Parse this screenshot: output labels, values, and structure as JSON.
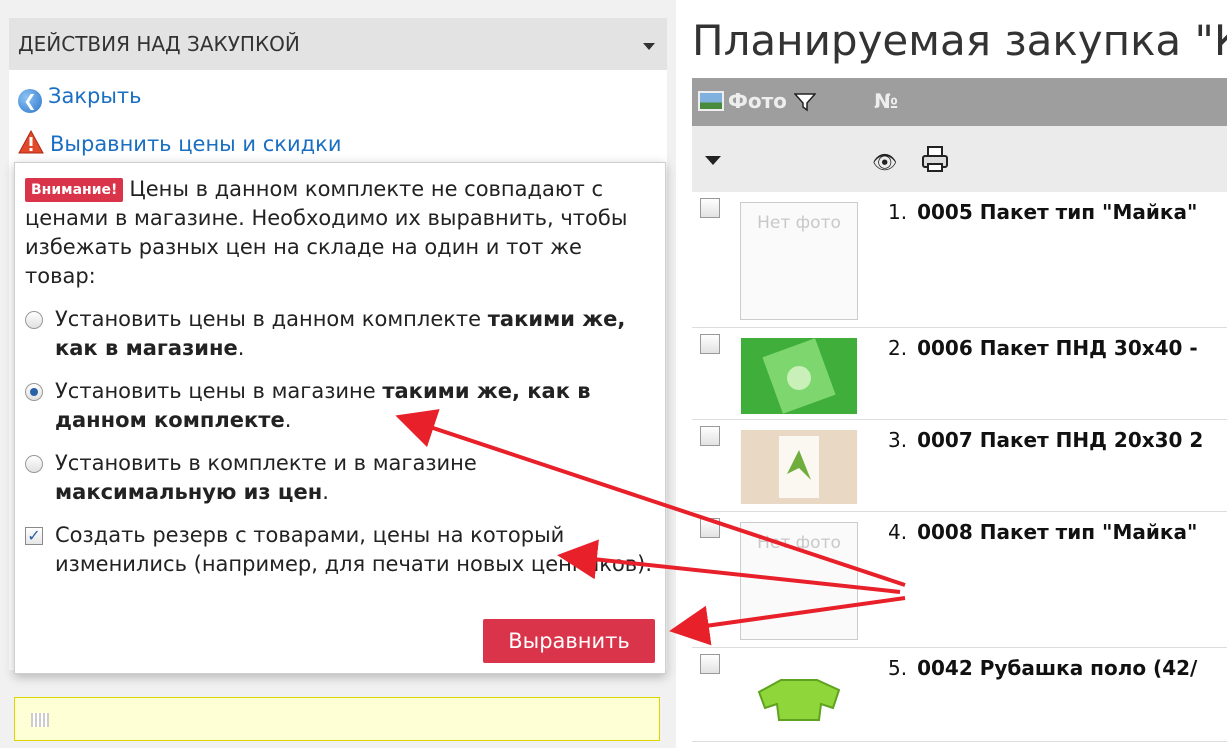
{
  "actions": {
    "header": "ДЕЙСТВИЯ НАД ЗАКУПКОЙ",
    "close_link": "Закрыть",
    "align_link": "Выравнить цены и скидки"
  },
  "popover": {
    "badge": "Внимание!",
    "warning": "Цены в данном комплекте не совпадают с ценами в магазине. Необходимо их выравнить, чтобы избежать разных цен на складе на один и тот же товар:",
    "options": [
      {
        "text": "Установить цены в данном комплекте ",
        "bold": "такими же, как в магазине",
        "end": ".",
        "selected": false
      },
      {
        "text": "Установить цены в магазине ",
        "bold": "такими же, как в данном комплекте",
        "end": ".",
        "selected": true
      },
      {
        "text": "Установить в комплекте и в магазине ",
        "bold": "максимальную из цен",
        "end": ".",
        "selected": false
      }
    ],
    "reserve_checkbox": {
      "text": "Создать резерв с товарами, цены на который изменились (например, для печати новых ценников).",
      "checked": true
    },
    "button": "Выравнить"
  },
  "page": {
    "title": "Планируемая закупка \"К"
  },
  "grid": {
    "photo_col": "Фото",
    "num_col": "№",
    "rows": [
      {
        "n": "1.",
        "title": "0005 Пакет тип \"Майка\"",
        "photo": "Нет фото"
      },
      {
        "n": "2.",
        "title": "0006 Пакет ПНД 30х40 -",
        "photo": ""
      },
      {
        "n": "3.",
        "title": "0007 Пакет ПНД 20х30 2",
        "photo": ""
      },
      {
        "n": "4.",
        "title": "0008 Пакет тип \"Майка\"",
        "photo": "Нет фото"
      },
      {
        "n": "5.",
        "title": "0042 Рубашка поло (42/",
        "photo": ""
      }
    ]
  },
  "colors": {
    "accent_red": "#d9344a",
    "link_blue": "#1a6fc2",
    "grid_header": "#9e9e9e",
    "arrow": "#e8202a"
  }
}
